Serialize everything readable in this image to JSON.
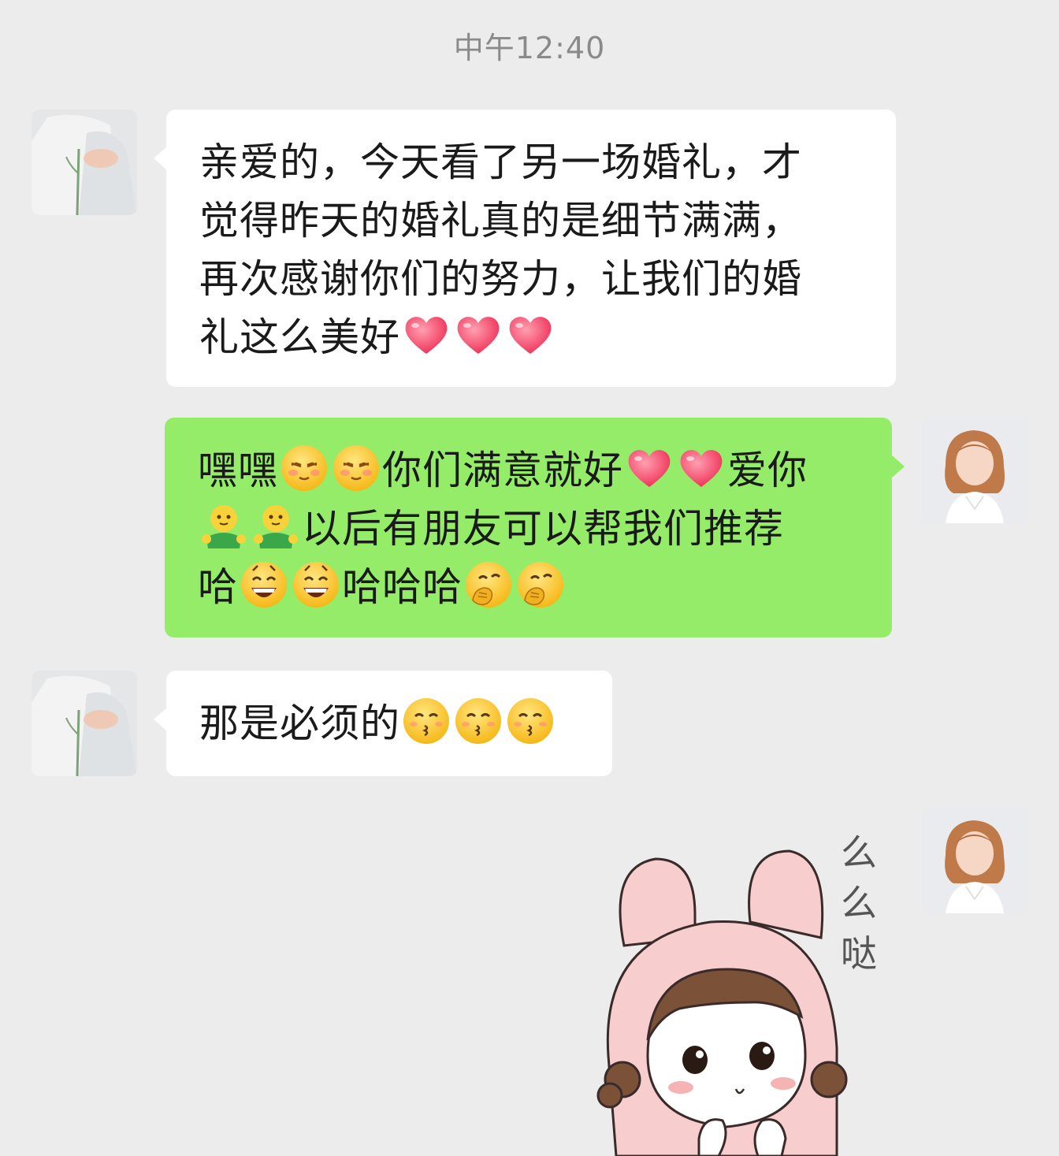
{
  "timestamp": "中午12:40",
  "messages": [
    {
      "side": "in",
      "lines": [
        "亲爱的，今天看了另一场婚礼，才",
        "觉得昨天的婚礼真的是细节满满，",
        "再次感谢你们的努力，让我们的婚"
      ],
      "last_line_text": "礼这么美好",
      "emoji": [
        "heart",
        "heart",
        "heart"
      ]
    },
    {
      "side": "out",
      "line1_a": "嘿嘿",
      "line1_b": "你们满意就好",
      "line1_c": "爱你",
      "line2_b": "以后有朋友可以帮我们推荐",
      "line3_a": "哈",
      "line3_b": "哈哈哈",
      "emoji_names": [
        "shy-face",
        "heart",
        "hug",
        "grin",
        "chuckle"
      ]
    },
    {
      "side": "in",
      "text": "那是必须的",
      "emoji": [
        "kiss-face",
        "kiss-face",
        "kiss-face"
      ]
    }
  ],
  "sticker": {
    "name": "bunny-hood-girl-sticker",
    "caption_chars": [
      "么",
      "么",
      "哒"
    ]
  },
  "colors": {
    "background": "#ececec",
    "incoming_bubble": "#ffffff",
    "outgoing_bubble": "#95ec69",
    "timestamp_text": "#8a8a8a"
  }
}
